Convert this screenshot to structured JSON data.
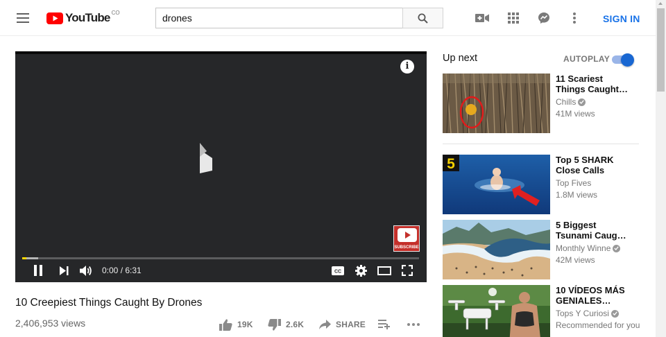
{
  "header": {
    "logo_text": "YouTube",
    "logo_region": "CO",
    "search_value": "drones",
    "signin_label": "SIGN IN"
  },
  "player": {
    "time": "0:00 / 6:31",
    "watermark_text": "SUBSCRIBE",
    "info_label": "i",
    "progress_played": 0.0,
    "progress_loaded": 0.04,
    "accent_color": "#ffd700"
  },
  "video": {
    "title": "10 Creepiest Things Caught By Drones",
    "views": "2,406,953 views",
    "likes": "19K",
    "dislikes": "2.6K",
    "share_label": "SHARE"
  },
  "sidebar": {
    "up_next_label": "Up next",
    "autoplay_label": "AUTOPLAY",
    "autoplay_on": true,
    "recommendations": [
      {
        "title": "11 Scariest Things Caught…",
        "channel": "Chills",
        "verified": true,
        "meta": "41M views"
      },
      {
        "title": "Top 5 SHARK Close Calls",
        "channel": "Top Fives",
        "verified": false,
        "meta": "1.8M views",
        "badge": "5"
      },
      {
        "title": "5 Biggest Tsunami Caug…",
        "channel": "Monthly Winne",
        "verified": true,
        "meta": "42M views"
      },
      {
        "title": "10 VÍDEOS MÁS GENIALES…",
        "channel": "Tops Y Curiosi",
        "verified": true,
        "meta": "Recommended for you"
      }
    ]
  },
  "icons": {
    "menu": "menu-icon",
    "search": "search-icon",
    "upload": "video-camera-icon",
    "apps": "apps-grid-icon",
    "messages": "messages-icon",
    "more": "more-vert-icon",
    "brand_color": "#ff0000",
    "link_color": "#1a73e8"
  }
}
